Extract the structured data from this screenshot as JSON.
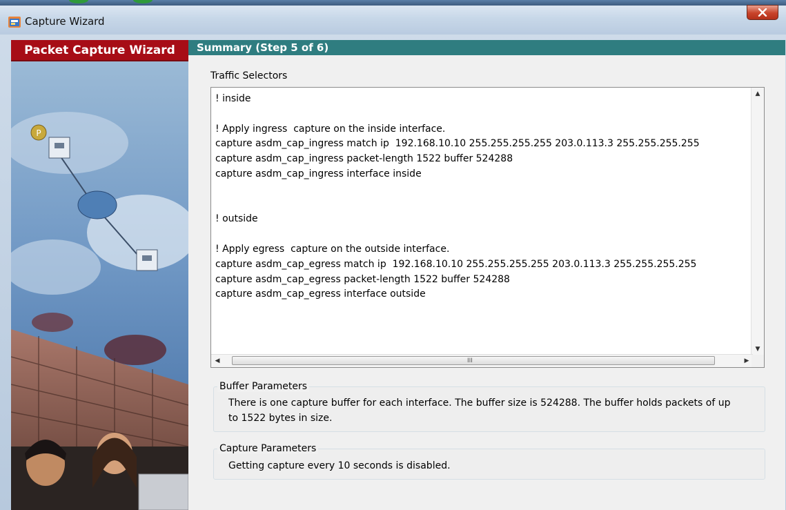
{
  "window": {
    "title": "Capture Wizard",
    "close_label": "X"
  },
  "banner": {
    "title": "Packet Capture Wizard"
  },
  "step": {
    "header": "Summary  (Step 5 of 6)"
  },
  "traffic_selectors": {
    "label": "Traffic Selectors",
    "lines": [
      "! inside",
      "",
      "! Apply ingress  capture on the inside interface.",
      "capture asdm_cap_ingress match ip  192.168.10.10 255.255.255.255 203.0.113.3 255.255.255.255",
      "capture asdm_cap_ingress packet-length 1522 buffer 524288",
      "capture asdm_cap_ingress interface inside",
      "",
      "",
      "! outside",
      "",
      "! Apply egress  capture on the outside interface.",
      "capture asdm_cap_egress match ip  192.168.10.10 255.255.255.255 203.0.113.3 255.255.255.255",
      "capture asdm_cap_egress packet-length 1522 buffer 524288",
      "capture asdm_cap_egress interface outside"
    ],
    "scroll_grip": "III"
  },
  "buffer_parameters": {
    "label": "Buffer Parameters",
    "text": "There is one capture buffer for each interface. The buffer size is 524288. The buffer holds packets of up to 1522 bytes in size."
  },
  "capture_parameters": {
    "label": "Capture Parameters",
    "text": "Getting capture every 10 seconds is disabled."
  },
  "colors": {
    "banner_red": "#a70d16",
    "header_teal": "#2f7d80",
    "close_red": "#c8432a"
  }
}
